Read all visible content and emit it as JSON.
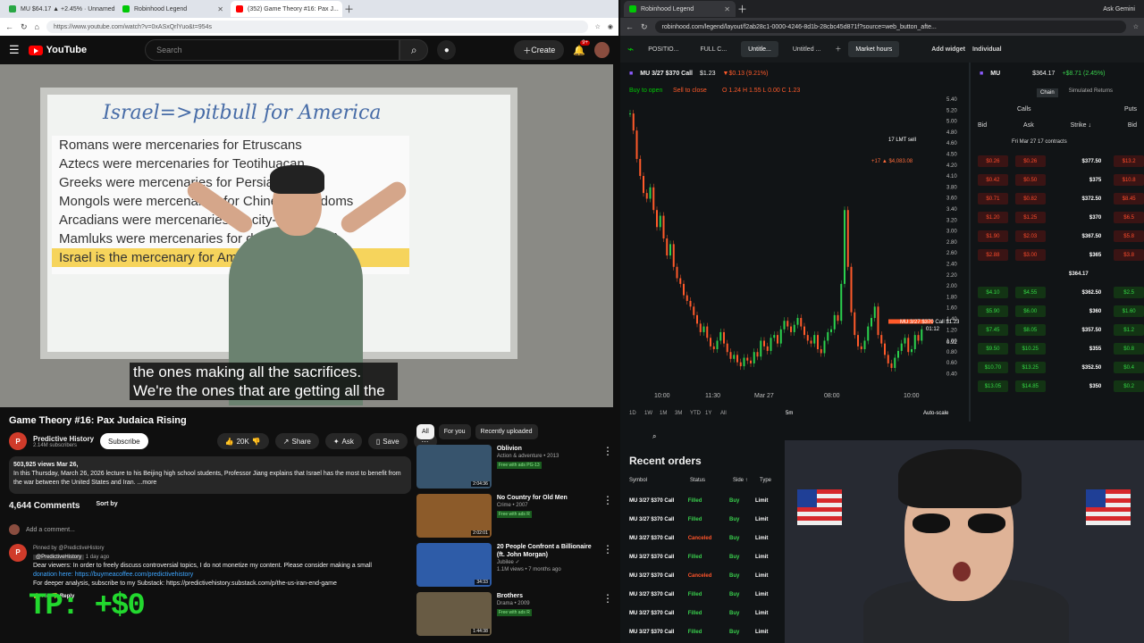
{
  "left_browser": {
    "tabs": [
      {
        "label": "MU $64.17 ▲ +2.45% · Unnamed",
        "color": "#29a745"
      },
      {
        "label": "Robinhood Legend",
        "color": "#00c805"
      },
      {
        "label": "(352) Game Theory #16: Pax J...",
        "color": "#ff0000"
      }
    ],
    "url": "https://www.youtube.com/watch?v=0xASxQrlYuo&t=954s"
  },
  "youtube": {
    "logo": "YouTube",
    "search_placeholder": "Search",
    "create": "Create",
    "notifications": "9+",
    "board_title": "Israel=>pitbull for America",
    "board_lines": [
      "Romans were mercenaries for Etruscans",
      "Aztecs were mercenaries for Teotihuacan",
      "Greeks were mercenaries for Persians",
      "Mongols were mercenaries for Chinese kingdoms",
      "Arcadians were mercenaries for city-states",
      "Mamluks were mercenaries for dynasty (Egypt)",
      "Israel is the mercenary for America"
    ],
    "subtitle_1": "the ones making all the sacrifices.",
    "subtitle_2": "We're the ones that are getting all the",
    "video_title": "Game Theory #16: Pax Judaica Rising",
    "channel": "Predictive History",
    "subscribers": "2.14M subscribers",
    "subscribe": "Subscribe",
    "likes": "20K",
    "share": "Share",
    "ask": "Ask",
    "save": "Save",
    "views": "503,925 views",
    "date": "Mar 26,",
    "description": "In this Thursday, March 26, 2026 lecture to his Beijing high school students, Professor Jiang explains that Israel has the most to benefit from the war between the United States and Iran. ...more",
    "comments_count": "4,644 Comments",
    "sort": "Sort by",
    "add_comment": "Add a comment...",
    "pinned": "Pinned by @PredictiveHistory",
    "commenter": "@PredictiveHistory",
    "comment_age": "1 day ago",
    "comment_1": "Dear viewers: In order to freely discuss controversial topics, I do not monetize my content. Please consider making a small",
    "comment_2": "donation here: https://buymeacoffee.com/predictivehistory",
    "comment_3": "For deeper analysis, subscribe to my Substack: https://predictivehistory.substack.com/p/the-us-iran-end-game",
    "comment_likes": "763",
    "reply": "Reply",
    "overlay": "TP: +$0",
    "chips": [
      "All",
      "For you",
      "Recently uploaded"
    ],
    "recommendations": [
      {
        "title": "Oblivion",
        "meta": "Action & adventure • 2013",
        "badge": "Free with ads  PG-13",
        "duration": "2:04:36",
        "thumb": "#37546d"
      },
      {
        "title": "No Country for Old Men",
        "meta": "Crime • 2007",
        "badge": "Free with ads  R",
        "duration": "2:02:01",
        "thumb": "#8c5b2a"
      },
      {
        "title": "20 People Confront a Billionaire (ft. John Morgan)",
        "meta": "Jubilee ✓",
        "badge": "1.1M views • 7 months ago",
        "duration": "34:33",
        "thumb": "#2e5ca8"
      },
      {
        "title": "Brothers",
        "meta": "Drama • 2009",
        "badge": "Free with ads  R",
        "duration": "1:44:38",
        "thumb": "#685b44"
      }
    ]
  },
  "right_browser": {
    "tabs": [
      {
        "label": "Robinhood Legend",
        "color": "#00c805"
      }
    ],
    "url": "robinhood.com/legend/layout/f2ab28c1-0000-4246-8d1b-28cbc45d871f?source=web_button_afte...",
    "ask": "Ask Gemini"
  },
  "robinhood": {
    "toolbar": [
      "POSITIO...",
      "FULL C...",
      "Untitle...",
      "Untitled ..."
    ],
    "market": "Market hours",
    "add_widget": "Add widget",
    "account": "Individual",
    "contract": "MU 3/27 $370 Call",
    "price": "$1.23",
    "change": "▼$0.13 (9.21%)",
    "buy": "Buy to open",
    "sell": "Sell to close",
    "ohlc": "O 1.24  H 1.55  L 0.00  C 1.23",
    "chart_labels": {
      "top_price": "5.40",
      "mid_price": "2.20",
      "current": "MU 3/27 $370 Call $1.23",
      "current_time": "01:12",
      "l1": "17 LMT sell",
      "l2": "+17 ▲ $4,083.08",
      "ticks": [
        "10:00",
        "11:30",
        "Mar 27",
        "08:00",
        "10:00"
      ],
      "ranges": [
        "1D",
        "1W",
        "1M",
        "3M",
        "YTD",
        "1Y",
        "All"
      ],
      "interval": "5m",
      "autoscale": "Auto-scale",
      "value_092": "0.92"
    },
    "y_axis": [
      "5.40",
      "5.20",
      "5.00",
      "4.80",
      "4.60",
      "4.50",
      "4.20",
      "4.10",
      "3.80",
      "3.60",
      "3.40",
      "3.20",
      "3.00",
      "2.80",
      "2.60",
      "2.40",
      "2.20",
      "2.00",
      "1.80",
      "1.60",
      "1.40",
      "1.20",
      "1.00",
      "0.80",
      "0.60",
      "0.40"
    ],
    "chain_symbol": "MU",
    "chain_price": "$364.17",
    "chain_change": "+$8.71 (2.45%)",
    "chain": "Chain",
    "simulated": "Simulated Returns",
    "calls": "Calls",
    "puts": "Puts",
    "chain_headers": [
      "Bid",
      "Ask",
      "Strike ↓",
      "Bid"
    ],
    "expiry": "Fri  Mar 27  17 contracts",
    "spot": "$364.17",
    "chain_rows": [
      {
        "bid": "$0.26",
        "ask": "$0.26",
        "strike": "$377.50",
        "put": "$13.2"
      },
      {
        "bid": "$0.42",
        "ask": "$0.50",
        "strike": "$375",
        "put": "$10.8"
      },
      {
        "bid": "$0.71",
        "ask": "$0.82",
        "strike": "$372.50",
        "put": "$8.45"
      },
      {
        "bid": "$1.20",
        "ask": "$1.25",
        "strike": "$370",
        "put": "$6.5"
      },
      {
        "bid": "$1.90",
        "ask": "$2.03",
        "strike": "$367.50",
        "put": "$5.8"
      },
      {
        "bid": "$2.88",
        "ask": "$3.00",
        "strike": "$365",
        "put": "$3.8"
      },
      {
        "bid": "$4.10",
        "ask": "$4.55",
        "strike": "$362.50",
        "put": "$2.5"
      },
      {
        "bid": "$5.90",
        "ask": "$6.00",
        "strike": "$360",
        "put": "$1.60"
      },
      {
        "bid": "$7.45",
        "ask": "$8.05",
        "strike": "$357.50",
        "put": "$1.2"
      },
      {
        "bid": "$9.50",
        "ask": "$10.25",
        "strike": "$355",
        "put": "$0.8"
      },
      {
        "bid": "$10.70",
        "ask": "$13.25",
        "strike": "$352.50",
        "put": "$0.4"
      },
      {
        "bid": "$13.05",
        "ask": "$14.85",
        "strike": "$350",
        "put": "$0.2"
      }
    ],
    "orders_title": "Recent orders",
    "orders_headers": [
      "Symbol",
      "Status",
      "Side ↑",
      "Type"
    ],
    "orders": [
      {
        "symbol": "MU 3/27 $370 Call",
        "status": "Filled",
        "side": "Buy",
        "type": "Limit",
        "color": "#39d04d"
      },
      {
        "symbol": "MU 3/27 $370 Call",
        "status": "Filled",
        "side": "Buy",
        "type": "Limit",
        "color": "#39d04d"
      },
      {
        "symbol": "MU 3/27 $370 Call",
        "status": "Canceled",
        "side": "Buy",
        "type": "Limit",
        "color": "#ff542a"
      },
      {
        "symbol": "MU 3/27 $370 Call",
        "status": "Filled",
        "side": "Buy",
        "type": "Limit",
        "color": "#39d04d"
      },
      {
        "symbol": "MU 3/27 $370 Call",
        "status": "Canceled",
        "side": "Buy",
        "type": "Limit",
        "color": "#ff542a"
      },
      {
        "symbol": "MU 3/27 $370 Call",
        "status": "Filled",
        "side": "Buy",
        "type": "Limit",
        "color": "#39d04d"
      },
      {
        "symbol": "MU 3/27 $370 Call",
        "status": "Filled",
        "side": "Buy",
        "type": "Limit",
        "color": "#39d04d"
      },
      {
        "symbol": "MU 3/27 $370 Call",
        "status": "Filled",
        "side": "Buy",
        "type": "Limit",
        "color": "#39d04d"
      }
    ]
  },
  "candles": [
    5.1,
    4.8,
    4.3,
    4.0,
    3.7,
    3.6,
    3.8,
    3.4,
    3.1,
    3.3,
    2.9,
    2.6,
    2.8,
    2.4,
    2.2,
    2.1,
    1.9,
    1.8,
    1.7,
    1.55,
    1.4,
    1.25,
    1.35,
    1.15,
    1.0,
    0.95,
    1.1,
    1.25,
    1.05,
    0.9,
    0.78,
    0.85,
    0.72,
    0.65,
    0.8,
    0.75,
    0.7,
    0.9,
    0.82,
    1.1,
    1.0,
    0.92,
    1.15,
    1.2,
    1.05,
    1.3,
    1.45,
    1.35,
    1.25,
    1.38,
    1.5,
    1.35,
    1.2,
    1.1,
    1.05,
    1.2,
    0.95,
    0.88,
    1.1,
    1.25,
    1.3,
    1.55,
    1.45,
    2.1,
    3.4,
    2.4,
    1.6,
    1.2,
    1.0,
    0.95,
    1.1,
    1.35,
    1.5,
    1.7,
    1.2,
    1.05,
    0.85,
    0.7,
    0.62,
    0.8,
    0.92,
    1.05,
    1.15,
    0.9,
    0.95,
    1.2,
    1.1,
    1.3
  ]
}
